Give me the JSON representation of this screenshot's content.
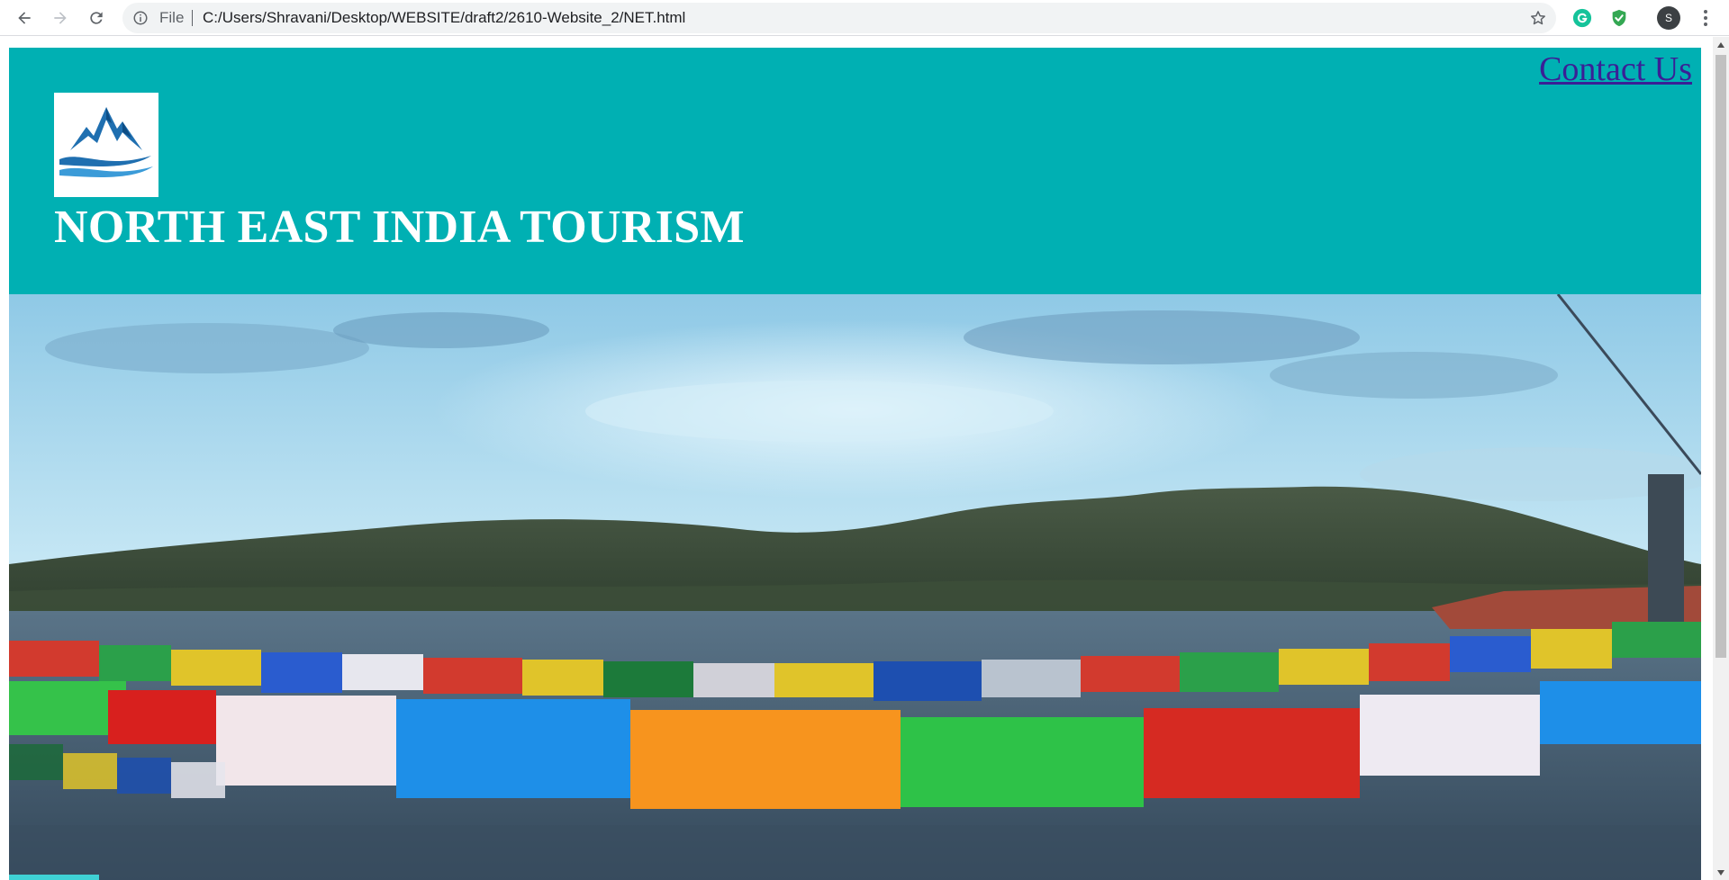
{
  "browser": {
    "scheme_label": "File",
    "url": "C:/Users/Shravani/Desktop/WEBSITE/draft2/2610-Website_2/NET.html",
    "profile_initial": "S",
    "accent_color": "#1a73e8"
  },
  "page": {
    "contact_link": "Contact Us",
    "site_title": "NORTH EAST INDIA TOURISM",
    "header_color": "#00b0b3",
    "link_color": "#3a1f96"
  },
  "icons": {
    "back": "back-arrow-icon",
    "forward": "forward-arrow-icon",
    "reload": "reload-icon",
    "info": "info-icon",
    "bookmark": "star-icon",
    "grammarly": "grammarly-icon",
    "shield_extension": "shield-check-icon",
    "menu": "kebab-menu-icon",
    "logo": "mountain-logo-icon"
  }
}
